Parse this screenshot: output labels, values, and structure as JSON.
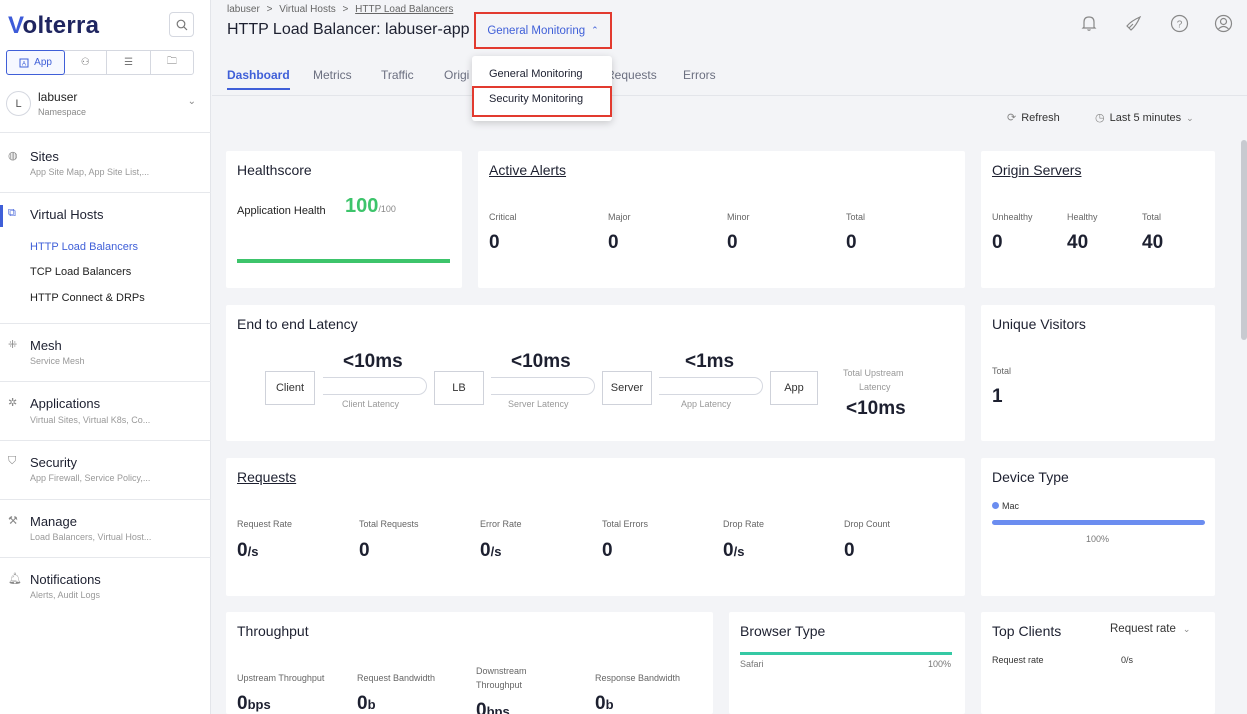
{
  "brand": {
    "logo_v": "V",
    "logo_rest": "olterra"
  },
  "workspace_tabs": [
    {
      "label": "App",
      "icon": "app-icon"
    },
    {
      "label": "",
      "icon": "user-group-icon"
    },
    {
      "label": "",
      "icon": "hierarchy-icon"
    },
    {
      "label": "",
      "icon": "folder-settings-icon"
    }
  ],
  "namespace": {
    "initial": "L",
    "name": "labuser",
    "label": "Namespace"
  },
  "nav": {
    "sites": {
      "label": "Sites",
      "sub": "App Site Map, App Site List,..."
    },
    "virtual_hosts": {
      "label": "Virtual Hosts",
      "items": [
        "HTTP Load Balancers",
        "TCP Load Balancers",
        "HTTP Connect & DRPs"
      ]
    },
    "mesh": {
      "label": "Mesh",
      "sub": "Service Mesh"
    },
    "applications": {
      "label": "Applications",
      "sub": "Virtual Sites, Virtual K8s, Co..."
    },
    "security": {
      "label": "Security",
      "sub": "App Firewall, Service Policy,..."
    },
    "manage": {
      "label": "Manage",
      "sub": "Load Balancers, Virtual Host..."
    },
    "notifications": {
      "label": "Notifications",
      "sub": "Alerts, Audit Logs"
    }
  },
  "breadcrumb": {
    "c1": "labuser",
    "c2": "Virtual Hosts",
    "c3": "HTTP Load Balancers",
    "sep": ">"
  },
  "page_title": "HTTP Load Balancer: labuser-app",
  "monitor": {
    "label": "General Monitoring",
    "options": [
      "General Monitoring",
      "Security Monitoring"
    ]
  },
  "tabs": [
    "Dashboard",
    "Metrics",
    "Traffic",
    "Origi",
    "Requests",
    "Errors"
  ],
  "toolbar": {
    "refresh": "Refresh",
    "time_range": "Last 5 minutes"
  },
  "healthscore": {
    "title": "Healthscore",
    "label": "Application Health",
    "value": "100",
    "max": "/100",
    "fraction": 1.0
  },
  "alerts": {
    "title": "Active Alerts",
    "labels": [
      "Critical",
      "Major",
      "Minor",
      "Total"
    ],
    "values": [
      "0",
      "0",
      "0",
      "0"
    ]
  },
  "origin": {
    "title": "Origin Servers",
    "labels": [
      "Unhealthy",
      "Healthy",
      "Total"
    ],
    "values": [
      "0",
      "40",
      "40"
    ]
  },
  "latency": {
    "title": "End to end Latency",
    "nodes": [
      "Client",
      "LB",
      "Server",
      "App"
    ],
    "values": [
      "<10ms",
      "<10ms",
      "<1ms"
    ],
    "labels": [
      "Client Latency",
      "Server Latency",
      "App Latency"
    ],
    "total_label_1": "Total Upstream",
    "total_label_2": "Latency",
    "total_value": "<10ms"
  },
  "visitors": {
    "title": "Unique Visitors",
    "label": "Total",
    "value": "1"
  },
  "requests": {
    "title": "Requests",
    "labels": [
      "Request Rate",
      "Total Requests",
      "Error Rate",
      "Total Errors",
      "Drop Rate",
      "Drop Count"
    ],
    "values": [
      "0",
      "0",
      "0",
      "0",
      "0",
      "0"
    ],
    "unit": "/s"
  },
  "device": {
    "title": "Device Type",
    "legend": "Mac",
    "pct": "100%",
    "fraction": 1.0
  },
  "throughput": {
    "title": "Throughput",
    "labels": [
      "Upstream Throughput",
      "Request Bandwidth",
      "Downstream",
      "Throughput",
      "Response Bandwidth"
    ],
    "values": [
      "0",
      "0",
      "0",
      "0"
    ],
    "units": [
      "bps",
      "b",
      "bps",
      "b"
    ]
  },
  "browser": {
    "title": "Browser Type",
    "name": "Safari",
    "pct": "100%",
    "fraction": 1.0
  },
  "top_clients": {
    "title": "Top Clients",
    "select": "Request rate",
    "col1": "Request rate",
    "col2": "0/s"
  },
  "colors": {
    "accent": "#3f5fd8",
    "health": "#3dc46b",
    "device_bar": "#6b8df0",
    "browser_bar": "#35c9a4",
    "highlight": "#e23a2f"
  }
}
